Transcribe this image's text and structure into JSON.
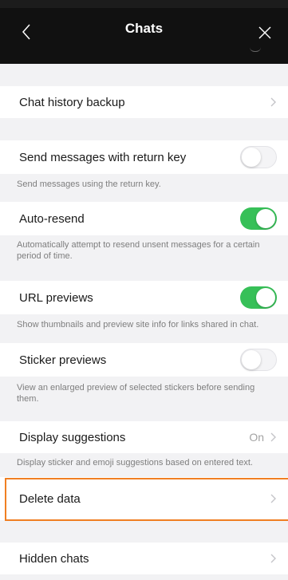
{
  "header": {
    "title": "Chats"
  },
  "rows": {
    "chat_history_backup": {
      "label": "Chat history backup"
    },
    "send_return": {
      "label": "Send messages with return key",
      "enabled": false,
      "desc": "Send messages using the return key."
    },
    "auto_resend": {
      "label": "Auto-resend",
      "enabled": true,
      "desc": "Automatically attempt to resend unsent messages for a certain period of time."
    },
    "url_previews": {
      "label": "URL previews",
      "enabled": true,
      "desc": "Show thumbnails and preview site info for links shared in chat."
    },
    "sticker_previews": {
      "label": "Sticker previews",
      "enabled": false,
      "desc": "View an enlarged preview of selected stickers before sending them."
    },
    "display_suggestions": {
      "label": "Display suggestions",
      "value": "On",
      "desc": "Display sticker and emoji suggestions based on entered text."
    },
    "delete_data": {
      "label": "Delete data"
    },
    "hidden_chats": {
      "label": "Hidden chats"
    }
  },
  "colors": {
    "toggle_on": "#37c058",
    "highlight": "#f07f22"
  },
  "icons": {
    "back": "chevron-left-icon",
    "close": "close-icon",
    "disclosure": "chevron-right-icon"
  }
}
